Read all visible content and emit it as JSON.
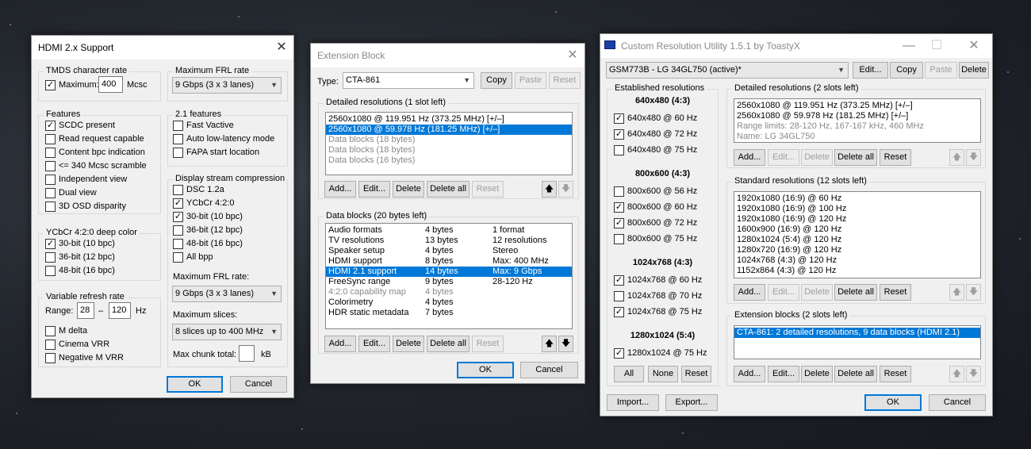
{
  "hdmi": {
    "title": "HDMI 2.x Support",
    "tmds": {
      "label": "TMDS character rate",
      "max_label": "Maximum:",
      "max_value": "400",
      "unit": "Mcsc"
    },
    "features": {
      "label": "Features",
      "items": [
        "SCDC present",
        "Read request capable",
        "Content bpc indication",
        "<= 340 Mcsc scramble",
        "Independent view",
        "Dual view",
        "3D OSD disparity"
      ],
      "checked": [
        true,
        false,
        false,
        false,
        false,
        false,
        false
      ]
    },
    "ycbcr": {
      "label": "YCbCr 4:2:0 deep color",
      "items": [
        "30-bit (10 bpc)",
        "36-bit (12 bpc)",
        "48-bit (16 bpc)"
      ],
      "checked": [
        true,
        false,
        false
      ]
    },
    "vrr": {
      "label": "Variable refresh rate",
      "range_label": "Range:",
      "min": "28",
      "dash": "–",
      "max": "120",
      "unit": "Hz",
      "items": [
        "M delta",
        "Cinema VRR",
        "Negative M VRR"
      ]
    },
    "frl": {
      "label": "Maximum FRL rate",
      "value": "9 Gbps (3 x 3 lanes)"
    },
    "f21": {
      "label": "2.1 features",
      "items": [
        "Fast Vactive",
        "Auto low-latency mode",
        "FAPA start location"
      ]
    },
    "dsc": {
      "label": "Display stream compression",
      "items": [
        "DSC 1.2a",
        "YCbCr 4:2:0",
        "30-bit (10 bpc)",
        "36-bit (12 bpc)",
        "48-bit (16 bpc)",
        "All bpp"
      ],
      "checked": [
        false,
        true,
        true,
        false,
        false,
        false
      ],
      "frl_label": "Maximum FRL rate:",
      "frl_value": "9 Gbps (3 x 3 lanes)",
      "slices_label": "Maximum slices:",
      "slices_value": "8 slices up to 400 MHz",
      "chunk_label": "Max chunk total:",
      "chunk_value": "",
      "chunk_unit": "kB"
    },
    "ok": "OK",
    "cancel": "Cancel"
  },
  "ext": {
    "title": "Extension Block",
    "type_label": "Type:",
    "type_value": "CTA-861",
    "copy": "Copy",
    "paste": "Paste",
    "reset": "Reset",
    "detailed": {
      "label": "Detailed resolutions (1 slot left)",
      "rows": [
        "2560x1080 @ 119.951 Hz (373.25 MHz) [+/–]",
        "2560x1080 @ 59.978 Hz (181.25 MHz) [+/–]",
        "Data blocks (18 bytes)",
        "Data blocks (18 bytes)",
        "Data blocks (16 bytes)"
      ]
    },
    "blocks": {
      "label": "Data blocks (20 bytes left)",
      "rows": [
        [
          "Audio formats",
          "4 bytes",
          "1 format"
        ],
        [
          "TV resolutions",
          "13 bytes",
          "12 resolutions"
        ],
        [
          "Speaker setup",
          "4 bytes",
          "Stereo"
        ],
        [
          "HDMI support",
          "8 bytes",
          "Max: 400 MHz"
        ],
        [
          "HDMI 2.1 support",
          "14 bytes",
          "Max: 9 Gbps"
        ],
        [
          "FreeSync range",
          "9 bytes",
          "28-120 Hz"
        ],
        [
          "4:2:0 capability map",
          "4 bytes",
          ""
        ],
        [
          "Colorimetry",
          "4 bytes",
          ""
        ],
        [
          "HDR static metadata",
          "7 bytes",
          ""
        ]
      ]
    },
    "add": "Add...",
    "edit": "Edit...",
    "delete": "Delete",
    "delete_all": "Delete all",
    "up": "🡅",
    "down": "🡇",
    "ok": "OK",
    "cancel": "Cancel"
  },
  "cru": {
    "title": "Custom Resolution Utility 1.5.1 by ToastyX",
    "monitor": "GSM773B - LG 34GL750 (active)*",
    "edit": "Edit...",
    "copy": "Copy",
    "paste": "Paste",
    "delete": "Delete",
    "established": {
      "label": "Established resolutions",
      "groups": [
        {
          "head": "640x480 (4:3)",
          "items": [
            "640x480 @ 60 Hz",
            "640x480 @ 72 Hz",
            "640x480 @ 75 Hz"
          ],
          "checked": [
            true,
            true,
            false
          ]
        },
        {
          "head": "800x600 (4:3)",
          "items": [
            "800x600 @ 56 Hz",
            "800x600 @ 60 Hz",
            "800x600 @ 72 Hz",
            "800x600 @ 75 Hz"
          ],
          "checked": [
            false,
            true,
            true,
            false
          ]
        },
        {
          "head": "1024x768 (4:3)",
          "items": [
            "1024x768 @ 60 Hz",
            "1024x768 @ 70 Hz",
            "1024x768 @ 75 Hz"
          ],
          "checked": [
            true,
            false,
            true
          ]
        },
        {
          "head": "1280x1024 (5:4)",
          "items": [
            "1280x1024 @ 75 Hz"
          ],
          "checked": [
            true
          ]
        }
      ],
      "all": "All",
      "none": "None",
      "reset": "Reset"
    },
    "detailed": {
      "label": "Detailed resolutions (2 slots left)",
      "rows": [
        "2560x1080 @ 119.951 Hz (373.25 MHz) [+/–]",
        "2560x1080 @ 59.978 Hz (181.25 MHz) [+/–]",
        "Range limits: 28-120 Hz, 167-167 kHz, 460 MHz",
        "Name: LG 34GL750"
      ]
    },
    "standard": {
      "label": "Standard resolutions (12 slots left)",
      "rows": [
        "1920x1080 (16:9) @ 60 Hz",
        "1920x1080 (16:9) @ 100 Hz",
        "1920x1080 (16:9) @ 120 Hz",
        "1600x900 (16:9) @ 120 Hz",
        "1280x1024 (5:4) @ 120 Hz",
        "1280x720 (16:9) @ 120 Hz",
        "1024x768 (4:3) @ 120 Hz",
        "1152x864 (4:3) @ 120 Hz"
      ]
    },
    "extension": {
      "label": "Extension blocks (2 slots left)",
      "rows": [
        "CTA-861: 2 detailed resolutions, 9 data blocks (HDMI 2.1)"
      ]
    },
    "add": "Add...",
    "edit2": "Edit...",
    "delete2": "Delete",
    "delete_all": "Delete all",
    "reset": "Reset",
    "up": "🡅",
    "down": "🡇",
    "import": "Import...",
    "export": "Export...",
    "ok": "OK",
    "cancel": "Cancel"
  }
}
